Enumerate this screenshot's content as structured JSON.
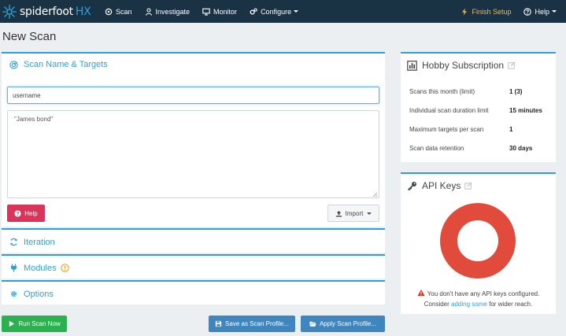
{
  "nav": {
    "brand_main": "spiderfoot",
    "brand_suffix": "HX",
    "scan": "Scan",
    "investigate": "Investigate",
    "monitor": "Monitor",
    "configure": "Configure",
    "finish_setup": "Finish Setup",
    "help": "Help"
  },
  "page": {
    "title": "New Scan"
  },
  "targets": {
    "heading": "Scan Name & Targets",
    "name_value": "username",
    "targets_value": "\"James bond\"",
    "help_label": "Help",
    "import_label": "Import"
  },
  "sections": {
    "iteration": "Iteration",
    "modules": "Modules",
    "options": "Options"
  },
  "buttons": {
    "run": "Run Scan Now",
    "save_profile": "Save as Scan Profile...",
    "apply_profile": "Apply Scan Profile..."
  },
  "subscription": {
    "heading": "Hobby Subscription",
    "rows": [
      {
        "key": "Scans this month (limit)",
        "value": "1 (3)"
      },
      {
        "key": "Individual scan duration limit",
        "value": "15 minutes"
      },
      {
        "key": "Maximum targets per scan",
        "value": "1"
      },
      {
        "key": "Scan data retention",
        "value": "30 days"
      }
    ]
  },
  "api_keys": {
    "heading": "API Keys",
    "message_line1": "You don't have any API keys configured.",
    "message_pre": "Consider",
    "message_link": "adding some",
    "message_post": "for wider reach."
  },
  "colors": {
    "navbar": "#1a3344",
    "accent": "#2f9fd8",
    "finish_setup": "#f0b94b",
    "help_button": "#d9345a",
    "run_button": "#2bb14d",
    "profile_buttons": "#3f86bf",
    "donut": "#e04b3b",
    "warning": "#d9342b"
  }
}
